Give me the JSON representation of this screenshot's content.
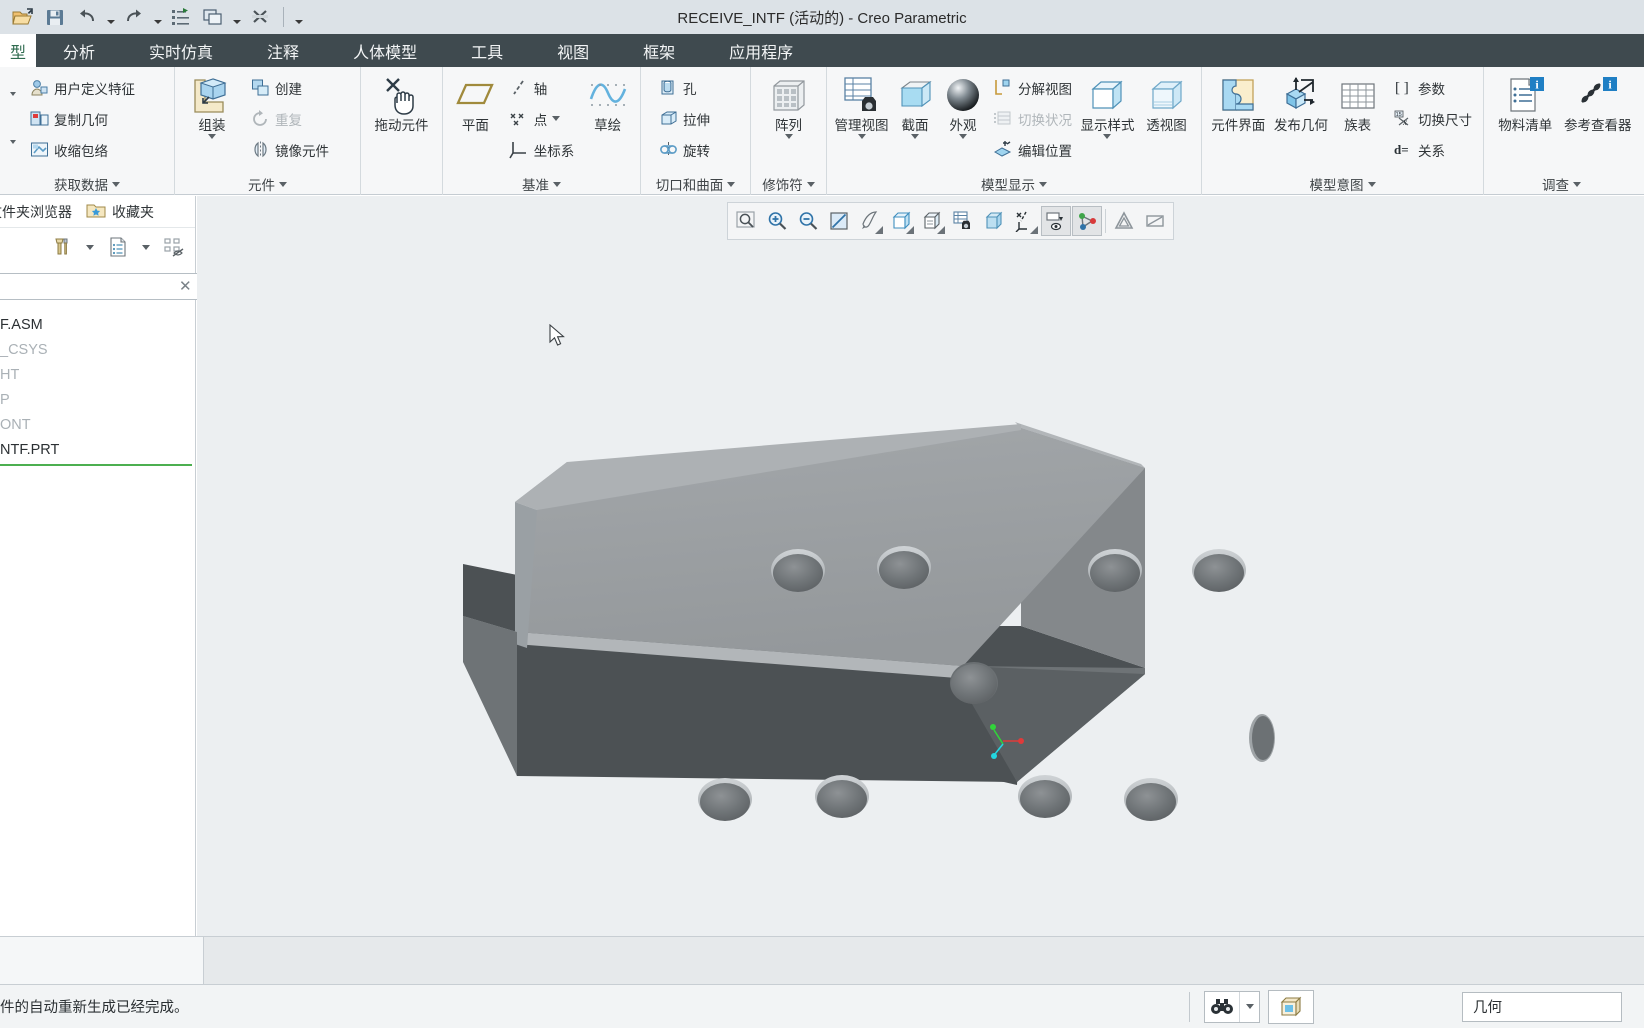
{
  "titlebar": {
    "title": "RECEIVE_INTF (活动的) - Creo Parametric",
    "quick_access": [
      {
        "name": "open-icon",
        "label": "打开"
      },
      {
        "name": "save-icon",
        "label": "保存"
      },
      {
        "name": "undo-icon",
        "label": "撤销"
      },
      {
        "name": "redo-icon",
        "label": "重做"
      },
      {
        "name": "regenerate-icon",
        "label": "重新生成"
      },
      {
        "name": "window-icon",
        "label": "窗口"
      },
      {
        "name": "close-window-icon",
        "label": "关闭"
      },
      {
        "name": "customize-icon",
        "label": "自定义快速访问工具栏"
      }
    ]
  },
  "tabs": {
    "active": "型",
    "items": [
      "分析",
      "实时仿真",
      "注释",
      "人体模型",
      "工具",
      "视图",
      "框架",
      "应用程序"
    ]
  },
  "ribbon": {
    "groups": [
      {
        "title": "获取数据",
        "items": [
          {
            "label": "用户定义特征",
            "icon": "udf-icon",
            "disabled": false
          },
          {
            "label": "复制几何",
            "icon": "copy-geometry-icon",
            "disabled": false
          },
          {
            "label": "收缩包络",
            "icon": "shrinkwrap-icon",
            "disabled": false
          }
        ]
      },
      {
        "title": "元件",
        "big": {
          "label": "组装",
          "icon": "assemble-icon",
          "has_caret": true
        },
        "items": [
          {
            "label": "创建",
            "icon": "create-icon",
            "disabled": false
          },
          {
            "label": "重复",
            "icon": "repeat-icon",
            "disabled": true
          },
          {
            "label": "镜像元件",
            "icon": "mirror-component-icon",
            "disabled": false
          }
        ]
      },
      {
        "title": "",
        "big": {
          "label": "拖动元件",
          "icon": "drag-component-icon",
          "has_caret": false
        }
      },
      {
        "title": "基准",
        "big": {
          "label": "平面",
          "icon": "datum-plane-icon",
          "has_caret": false
        },
        "items": [
          {
            "label": "轴",
            "icon": "axis-icon",
            "disabled": false
          },
          {
            "label": "点",
            "icon": "point-icon",
            "disabled": false,
            "caret": true
          },
          {
            "label": "坐标系",
            "icon": "coordinate-system-icon",
            "disabled": false
          }
        ],
        "big2": {
          "label": "草绘",
          "icon": "sketch-icon",
          "has_caret": false
        }
      },
      {
        "title": "切口和曲面",
        "items": [
          {
            "label": "孔",
            "icon": "hole-icon",
            "disabled": false
          },
          {
            "label": "拉伸",
            "icon": "extrude-icon",
            "disabled": false
          },
          {
            "label": "旋转",
            "icon": "revolve-icon",
            "disabled": false
          }
        ]
      },
      {
        "title": "修饰符",
        "big": {
          "label": "阵列",
          "icon": "pattern-icon",
          "has_caret": true
        }
      },
      {
        "title": "模型显示",
        "bigs": [
          {
            "label": "管理视图",
            "icon": "manage-views-icon",
            "has_caret": true
          },
          {
            "label": "截面",
            "icon": "section-icon",
            "has_caret": true
          },
          {
            "label": "外观",
            "icon": "appearance-icon",
            "has_caret": true
          }
        ],
        "items": [
          {
            "label": "分解视图",
            "icon": "exploded-view-icon",
            "disabled": false
          },
          {
            "label": "切换状况",
            "icon": "toggle-status-icon",
            "disabled": true
          },
          {
            "label": "编辑位置",
            "icon": "edit-position-icon",
            "disabled": false
          }
        ],
        "bigs2": [
          {
            "label": "显示样式",
            "icon": "display-style-icon",
            "has_caret": true
          },
          {
            "label": "透视图",
            "icon": "perspective-view-icon",
            "has_caret": false
          }
        ]
      },
      {
        "title": "模型意图",
        "bigs": [
          {
            "label": "元件界面",
            "icon": "component-interface-icon",
            "has_caret": false
          },
          {
            "label": "发布几何",
            "icon": "publish-geometry-icon",
            "has_caret": false
          },
          {
            "label": "族表",
            "icon": "family-table-icon",
            "has_caret": false
          }
        ],
        "items": [
          {
            "label": "参数",
            "icon": "parameters-icon",
            "disabled": false
          },
          {
            "label": "切换尺寸",
            "icon": "switch-dimensions-icon",
            "disabled": false
          },
          {
            "label": "关系",
            "icon": "relations-icon",
            "disabled": false
          }
        ]
      },
      {
        "title": "调查",
        "bigs": [
          {
            "label": "物料清单",
            "icon": "bill-of-materials-icon",
            "has_caret": false
          },
          {
            "label": "参考查看器",
            "icon": "reference-viewer-icon",
            "has_caret": false
          }
        ]
      }
    ]
  },
  "navigator": {
    "tabs": [
      {
        "label": "文件夹浏览器",
        "icon": "folder-browser-icon"
      },
      {
        "label": "收藏夹",
        "icon": "favorites-icon"
      }
    ],
    "toolbar": [
      {
        "name": "settings-tools-icon"
      },
      {
        "name": "chevron-down-icon"
      },
      {
        "name": "show-tree-columns-icon"
      },
      {
        "name": "chevron-down-icon"
      },
      {
        "name": "filter-hidden-icon"
      }
    ],
    "search": {
      "value": "",
      "placeholder": "",
      "clear_icon": "close-icon",
      "dropdown_icon": "chevron-down-icon",
      "add_icon": "plus-icon"
    },
    "tree": [
      {
        "label": "F.ASM",
        "dim": false
      },
      {
        "label": "_CSYS",
        "dim": true
      },
      {
        "label": "HT",
        "dim": true
      },
      {
        "label": "P",
        "dim": true
      },
      {
        "label": "ONT",
        "dim": true
      },
      {
        "label": "NTF.PRT",
        "dim": false
      }
    ]
  },
  "viewport": {
    "graphics_toolbar": [
      {
        "name": "zoom-to-fit-icon",
        "selected": false,
        "caret": false
      },
      {
        "name": "zoom-in-icon",
        "selected": false,
        "caret": false
      },
      {
        "name": "zoom-out-icon",
        "selected": false,
        "caret": false
      },
      {
        "name": "refit-icon",
        "selected": false,
        "caret": false
      },
      {
        "name": "repaint-icon",
        "selected": false,
        "caret": true
      },
      {
        "name": "display-style-icon",
        "selected": false,
        "caret": true
      },
      {
        "name": "saved-views-icon",
        "selected": false,
        "caret": true
      },
      {
        "name": "view-manager-icon",
        "selected": false,
        "caret": false
      },
      {
        "name": "perspective-icon",
        "selected": false,
        "caret": false
      },
      {
        "name": "datum-display-icon",
        "selected": false,
        "caret": true
      },
      {
        "name": "annotation-display-icon",
        "selected": true,
        "caret": false
      },
      {
        "name": "spin-center-icon",
        "selected": true,
        "caret": false
      },
      {
        "name": "appearance-gallery-icon",
        "selected": false,
        "caret": false
      },
      {
        "name": "section-display-icon",
        "selected": false,
        "caret": false
      }
    ],
    "model": {
      "name": "RECEIVE_INTF",
      "cursor_visible": true,
      "coordinate_system": {
        "x_axis_color": "#e03a3a",
        "y_axis_color": "#31d43a",
        "z_axis_color": "#23d7e0"
      },
      "colors": {
        "top_face": "#9a9ea1",
        "right_face": "#878b8f",
        "front_face": "#4c5154",
        "chamfer": "#b1b5b8",
        "background": "#eceff1"
      },
      "top_holes_front": 4,
      "top_holes_back": 4,
      "center_hole": 1,
      "side_holes": 1
    }
  },
  "statusbar": {
    "message": "件的自动重新生成已经完成。",
    "search_icon": "binoculars-icon",
    "search_caret_icon": "chevron-down-icon",
    "view_icon": "model-view-icon",
    "filter_value": "几何"
  }
}
